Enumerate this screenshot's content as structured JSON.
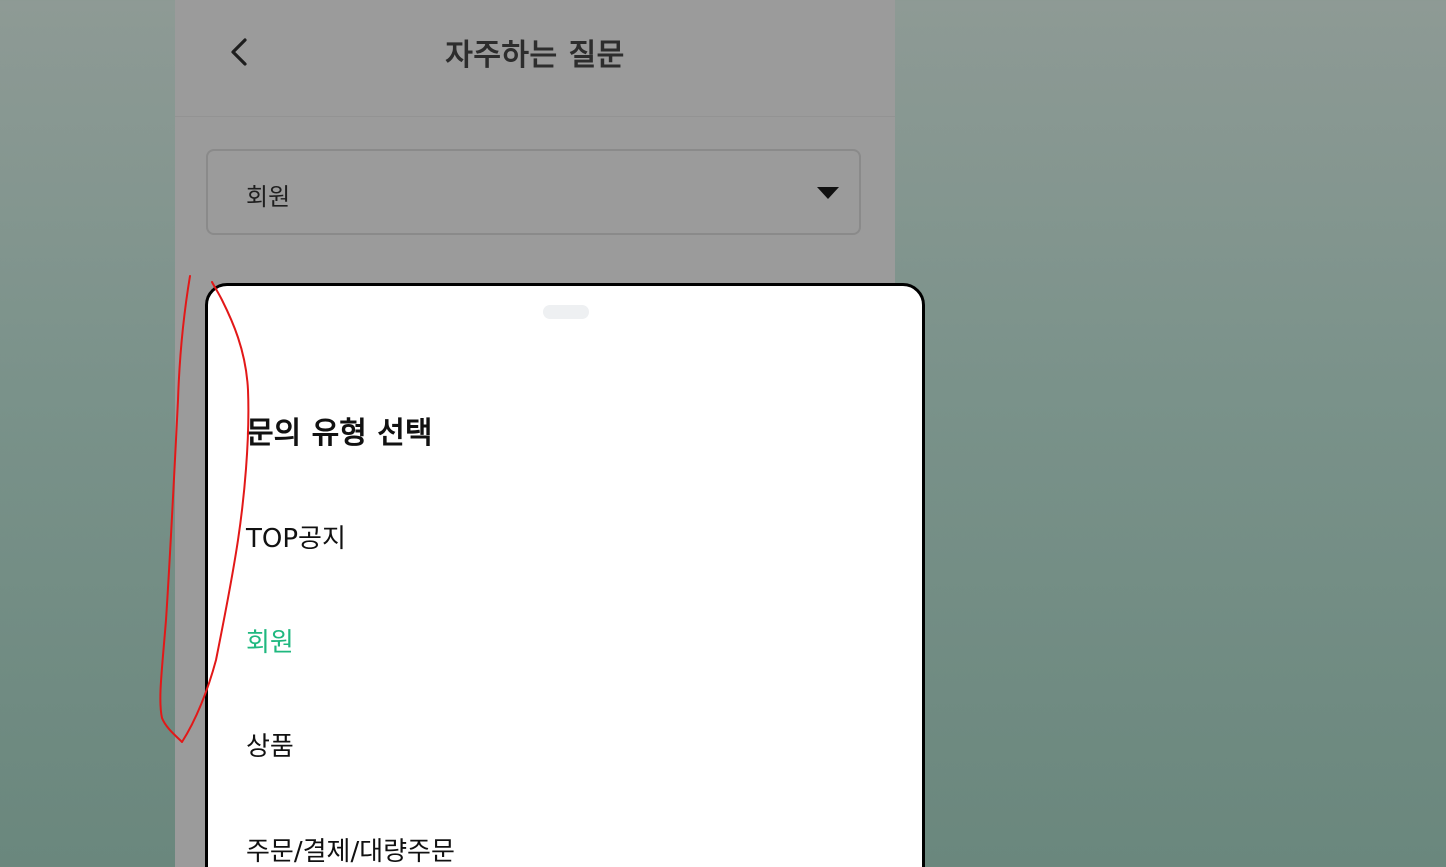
{
  "header": {
    "title": "자주하는 질문",
    "back_icon": "chevron-left-icon"
  },
  "category_select": {
    "value": "회원",
    "caret_icon": "caret-down-icon"
  },
  "bottom_sheet": {
    "title": "문의 유형 선택",
    "options": [
      {
        "label": "TOP공지",
        "selected": false
      },
      {
        "label": "회원",
        "selected": true
      },
      {
        "label": "상품",
        "selected": false
      },
      {
        "label": "주문/결제/대량주문",
        "selected": false
      }
    ]
  },
  "colors": {
    "selected_option": "#1fb87f",
    "annotation_stroke": "#e21818",
    "overlay_dim": "#9b9b9b"
  }
}
